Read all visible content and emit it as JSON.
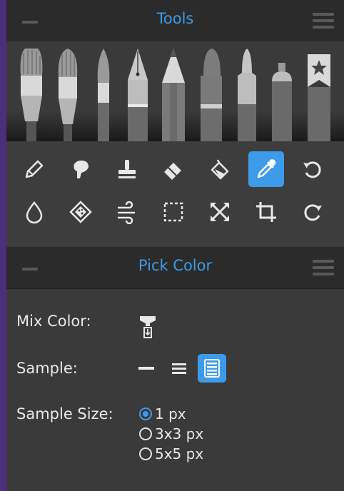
{
  "tools_panel": {
    "title": "Tools"
  },
  "pick_panel": {
    "title": "Pick Color",
    "mix_color_label": "Mix Color:",
    "sample_label": "Sample:",
    "sample_size_label": "Sample Size:",
    "sample_options": [
      "single-line",
      "three-lines",
      "all-layers"
    ],
    "sample_selected": "all-layers",
    "size_options": [
      "1 px",
      "3x3 px",
      "5x5 px"
    ],
    "size_selected": "1 px"
  },
  "brushes": [
    "wide-brush",
    "round-brush",
    "small-brush",
    "ink-pen",
    "pencil",
    "marker",
    "felt-pen",
    "airbrush",
    "custom-brush"
  ],
  "tools_row1": [
    "pencil-icon",
    "smudge-icon",
    "stamp-icon",
    "eraser-icon",
    "fill-bucket-icon",
    "eyedropper-icon",
    "undo-icon"
  ],
  "tools_row2": [
    "water-drop-icon",
    "texture-icon",
    "blow-icon",
    "selection-icon",
    "transform-icon",
    "crop-icon",
    "redo-icon"
  ],
  "active_tool": "eyedropper-icon",
  "colors": {
    "accent": "#3d9be9",
    "panel": "#3d3d3d",
    "header": "#2b2b2b",
    "frame": "#4a2f7a"
  }
}
